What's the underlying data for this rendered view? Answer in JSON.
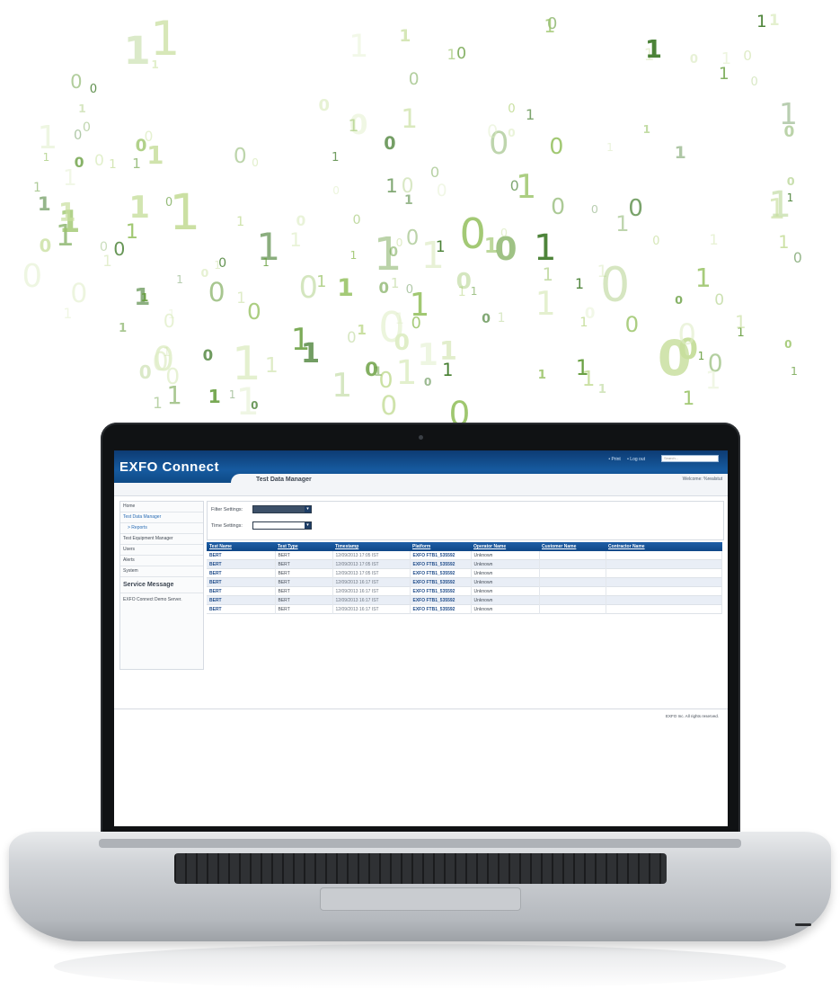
{
  "app": {
    "logo": "EXFO Connect",
    "page_title": "Test Data Manager",
    "welcome": "Welcome: %realstut",
    "top_links": [
      "• Print",
      "• Log out"
    ],
    "search_placeholder": "Search..."
  },
  "sidebar": {
    "items": [
      {
        "label": "Home"
      },
      {
        "label": "Test Data Manager"
      },
      {
        "label": "> Reports"
      },
      {
        "label": "Test Equipment Manager"
      },
      {
        "label": "Users"
      },
      {
        "label": "Alerts"
      },
      {
        "label": "System"
      }
    ],
    "section_title": "Service Message",
    "section_text": "EXFO Connect Demo Server."
  },
  "filters": {
    "filter_label": "Filter Settings:",
    "time_label": "Time Settings:"
  },
  "table": {
    "columns": [
      "Test Name",
      "Test Type",
      "Timestamp",
      "Platform",
      "Operator Name",
      "Customer Name",
      "Contractor Name"
    ],
    "rows": [
      [
        "BERT",
        "BERT",
        "12/09/2013 17:05 IST",
        "EXFO FTB1_535592",
        "Unknown",
        "",
        ""
      ],
      [
        "BERT",
        "BERT",
        "12/09/2013 17:05 IST",
        "EXFO FTB1_535592",
        "Unknown",
        "",
        ""
      ],
      [
        "BERT",
        "BERT",
        "12/09/2013 17:05 IST",
        "EXFO FTB1_535592",
        "Unknown",
        "",
        ""
      ],
      [
        "BERT",
        "BERT",
        "12/09/2013 16:17 IST",
        "EXFO FTB1_535592",
        "Unknown",
        "",
        ""
      ],
      [
        "BERT",
        "BERT",
        "12/09/2013 16:17 IST",
        "EXFO FTB1_535592",
        "Unknown",
        "",
        ""
      ],
      [
        "BERT",
        "BERT",
        "12/09/2013 16:17 IST",
        "EXFO FTB1_535592",
        "Unknown",
        "",
        ""
      ],
      [
        "BERT",
        "BERT",
        "12/09/2013 16:17 IST",
        "EXFO FTB1_535592",
        "Unknown",
        "",
        ""
      ]
    ]
  },
  "footer": {
    "copyright": "EXFO Inc. All rights reserved."
  },
  "colors": {
    "header_blue": "#165a9f",
    "digit_greens": [
      "#9ec66d",
      "#6aa042",
      "#3f7a2a",
      "#c8df9e",
      "#dfeec6"
    ]
  }
}
